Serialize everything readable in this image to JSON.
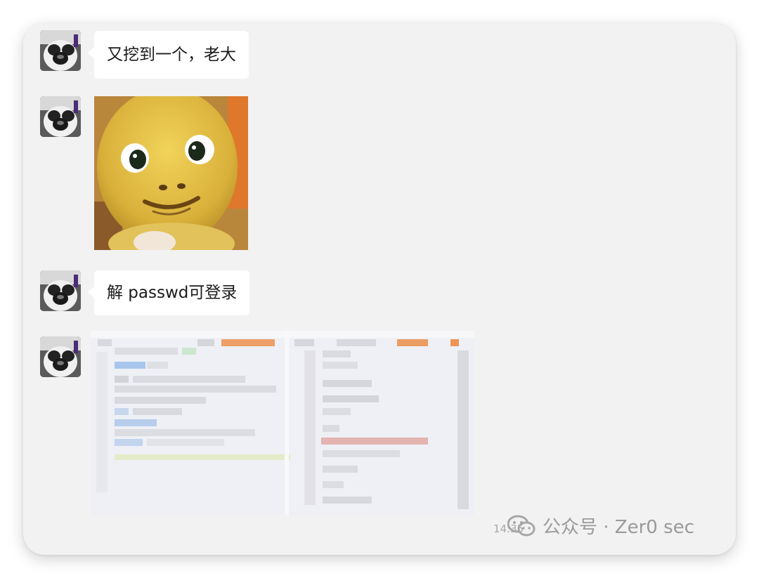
{
  "chat": {
    "messages": [
      {
        "type": "text",
        "text": "又挖到一个，老大"
      },
      {
        "type": "sticker",
        "icon": "yellow-creature-sticker"
      },
      {
        "type": "text",
        "text": "解 passwd可登录"
      },
      {
        "type": "image",
        "icon": "blurred-screenshot-image"
      }
    ]
  },
  "watermark": {
    "text": "公众号 · Zer0 sec",
    "timestamp": "14:35",
    "icon": "wechat-icon"
  },
  "colors": {
    "card_bg": "#f2f2f2",
    "bubble_bg": "#ffffff",
    "text": "#1b1b1b",
    "watermark": "#9a9a9a"
  }
}
